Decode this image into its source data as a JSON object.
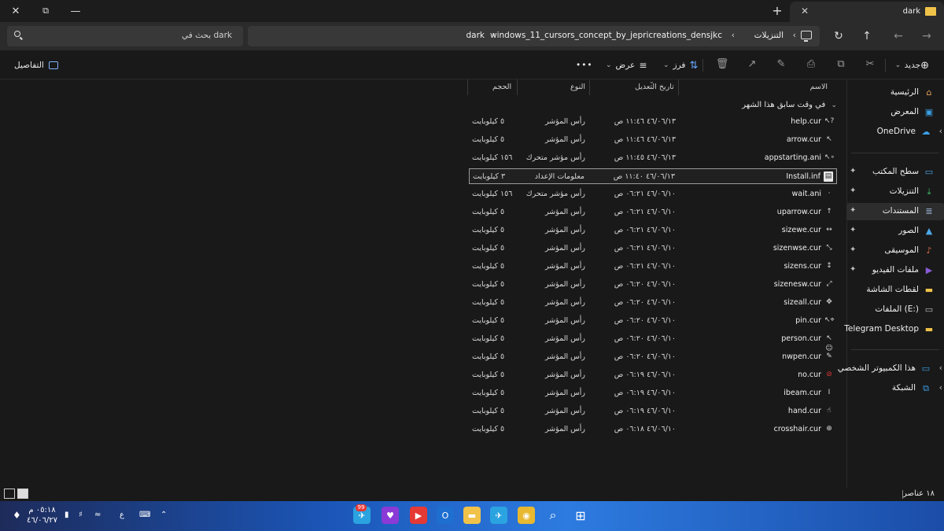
{
  "window": {
    "tab_title": "dark",
    "new_tab_symbol": "+",
    "close_symbol": "✕",
    "minimize_symbol": "—",
    "restore_symbol": "⧉"
  },
  "address": {
    "crumbs": [
      "dark",
      "windows_11_cursors_concept_by_jepricreations_densjkc",
      "التنزيلات"
    ],
    "search_placeholder": "بحث في dark"
  },
  "commands": {
    "new_label": "جديد",
    "sort_label": "فرز",
    "view_label": "عرض",
    "more_label": "•••",
    "details_label": "التفاصيل"
  },
  "nav": [
    {
      "label": "الرئيسية",
      "icon": "home-icon",
      "glyph": "⌂",
      "color": "#e8a35a",
      "group": 1
    },
    {
      "label": "المعرض",
      "icon": "gallery-icon",
      "glyph": "▣",
      "color": "#3aa0e6",
      "group": 1
    },
    {
      "label": "OneDrive",
      "icon": "cloud-icon",
      "glyph": "☁",
      "color": "#3aa0e6",
      "group": 1,
      "chev": true
    },
    {
      "label": "سطح المكتب",
      "icon": "desktop-icon",
      "glyph": "▭",
      "color": "#4aa8e8",
      "group": 2,
      "pin": true
    },
    {
      "label": "التنزيلات",
      "icon": "download-icon",
      "glyph": "⤓",
      "color": "#3cc46a",
      "group": 2,
      "pin": true
    },
    {
      "label": "المستندات",
      "icon": "document-icon",
      "glyph": "≣",
      "color": "#9ab6d6",
      "group": 2,
      "pin": true,
      "selected": true
    },
    {
      "label": "الصور",
      "icon": "pictures-icon",
      "glyph": "▲",
      "color": "#4aa8e8",
      "group": 2,
      "pin": true
    },
    {
      "label": "الموسيقى",
      "icon": "music-icon",
      "glyph": "♪",
      "color": "#e07050",
      "group": 2,
      "pin": true
    },
    {
      "label": "ملفات الفيديو",
      "icon": "video-icon",
      "glyph": "▶",
      "color": "#8a5ad6",
      "group": 2,
      "pin": true
    },
    {
      "label": "لقطات الشاشة",
      "icon": "folder-icon",
      "glyph": "▬",
      "color": "#f0c24a",
      "group": 2
    },
    {
      "label": "الملفات (E:)",
      "icon": "drive-icon",
      "glyph": "▭",
      "color": "#bdbdbd",
      "group": 2
    },
    {
      "label": "Telegram Desktop",
      "icon": "folder-icon",
      "glyph": "▬",
      "color": "#f0c24a",
      "group": 2
    },
    {
      "label": "هذا الكمبيوتر الشخصي",
      "icon": "pc-icon",
      "glyph": "▭",
      "color": "#3aa0e6",
      "group": 3,
      "chev": true
    },
    {
      "label": "الشبكة",
      "icon": "network-icon",
      "glyph": "⧉",
      "color": "#3aa0e6",
      "group": 3,
      "chev": true
    }
  ],
  "columns": {
    "name": "الاسم",
    "date": "تاريخ التعديل",
    "type": "النوع",
    "size": "الحجم"
  },
  "group_header": "في وقت سابق هذا الشهر",
  "files": [
    {
      "name": "help.cur",
      "date": "٤٦/٠٦/١٣ ١١:٤٦ ص",
      "type": "رأس المؤشر",
      "size": "٥ كيلوبايت",
      "icon": "help-cursor-icon",
      "glyph": "↖?"
    },
    {
      "name": "arrow.cur",
      "date": "٤٦/٠٦/١٣ ١١:٤٦ ص",
      "type": "رأس المؤشر",
      "size": "٥ كيلوبايت",
      "icon": "arrow-cursor-icon",
      "glyph": "↖"
    },
    {
      "name": "appstarting.ani",
      "date": "٤٦/٠٦/١٣ ١١:٤٥ ص",
      "type": "رأس مؤشر متحرك",
      "size": "١٥٦ كيلوبايت",
      "icon": "busy-arrow-cursor-icon",
      "glyph": "↖∘"
    },
    {
      "name": "Install.inf",
      "date": "٤٦/٠٦/١٣ ١١:٤٠ ص",
      "type": "معلومات الإعداد",
      "size": "٣ كيلوبايت",
      "icon": "setup-file-icon",
      "glyph": "▤",
      "selected": true
    },
    {
      "name": "wait.ani",
      "date": "٤٦/٠٦/١٠ ٠٦:٢١ ص",
      "type": "رأس مؤشر متحرك",
      "size": "١٥٦ كيلوبايت",
      "icon": "wait-cursor-icon",
      "glyph": "·"
    },
    {
      "name": "uparrow.cur",
      "date": "٤٦/٠٦/١٠ ٠٦:٢١ ص",
      "type": "رأس المؤشر",
      "size": "٥ كيلوبايت",
      "icon": "uparrow-cursor-icon",
      "glyph": "↑"
    },
    {
      "name": "sizewe.cur",
      "date": "٤٦/٠٦/١٠ ٠٦:٢١ ص",
      "type": "رأس المؤشر",
      "size": "٥ كيلوبايت",
      "icon": "size-we-cursor-icon",
      "glyph": "↔"
    },
    {
      "name": "sizenwse.cur",
      "date": "٤٦/٠٦/١٠ ٠٦:٢١ ص",
      "type": "رأس المؤشر",
      "size": "٥ كيلوبايت",
      "icon": "size-nwse-cursor-icon",
      "glyph": "⤡"
    },
    {
      "name": "sizens.cur",
      "date": "٤٦/٠٦/١٠ ٠٦:٢١ ص",
      "type": "رأس المؤشر",
      "size": "٥ كيلوبايت",
      "icon": "size-ns-cursor-icon",
      "glyph": "↕"
    },
    {
      "name": "sizenesw.cur",
      "date": "٤٦/٠٦/١٠ ٠٦:٢٠ ص",
      "type": "رأس المؤشر",
      "size": "٥ كيلوبايت",
      "icon": "size-nesw-cursor-icon",
      "glyph": "⤢"
    },
    {
      "name": "sizeall.cur",
      "date": "٤٦/٠٦/١٠ ٠٦:٢٠ ص",
      "type": "رأس المؤشر",
      "size": "٥ كيلوبايت",
      "icon": "move-cursor-icon",
      "glyph": "✥"
    },
    {
      "name": "pin.cur",
      "date": "٤٦/٠٦/١٠ ٠٦:٢٠ ص",
      "type": "رأس المؤشر",
      "size": "٥ كيلوبايت",
      "icon": "pin-cursor-icon",
      "glyph": "↖⌖"
    },
    {
      "name": "person.cur",
      "date": "٤٦/٠٦/١٠ ٠٦:٢٠ ص",
      "type": "رأس المؤشر",
      "size": "٥ كيلوبايت",
      "icon": "person-cursor-icon",
      "glyph": "↖☺"
    },
    {
      "name": "nwpen.cur",
      "date": "٤٦/٠٦/١٠ ٠٦:٢٠ ص",
      "type": "رأس المؤشر",
      "size": "٥ كيلوبايت",
      "icon": "pen-cursor-icon",
      "glyph": "✎"
    },
    {
      "name": "no.cur",
      "date": "٤٦/٠٦/١٠ ٠٦:١٩ ص",
      "type": "رأس المؤشر",
      "size": "٥ كيلوبايت",
      "icon": "no-cursor-icon",
      "glyph": "⊘",
      "glyph_color": "#e53935"
    },
    {
      "name": "ibeam.cur",
      "date": "٤٦/٠٦/١٠ ٠٦:١٩ ص",
      "type": "رأس المؤشر",
      "size": "٥ كيلوبايت",
      "icon": "ibeam-cursor-icon",
      "glyph": "I"
    },
    {
      "name": "hand.cur",
      "date": "٤٦/٠٦/١٠ ٠٦:١٩ ص",
      "type": "رأس المؤشر",
      "size": "٥ كيلوبايت",
      "icon": "hand-cursor-icon",
      "glyph": "☝"
    },
    {
      "name": "crosshair.cur",
      "date": "٤٦/٠٦/١٠ ٠٦:١٨ ص",
      "type": "رأس المؤشر",
      "size": "٥ كيلوبايت",
      "icon": "crosshair-cursor-icon",
      "glyph": "⊕"
    }
  ],
  "status": {
    "item_count": "١٨ عناصر"
  },
  "taskbar": {
    "clock_time": "٠٥:١٨ م",
    "clock_date": "٤٦/٠٦/٢٧",
    "keyboard_lang": "ع",
    "telegram_badge": "99",
    "apps": [
      {
        "icon": "telegram-icon",
        "glyph": "✈",
        "color": "#2aa3e0"
      },
      {
        "icon": "heart-app-icon",
        "glyph": "♥",
        "color": "#8a3ad6"
      },
      {
        "icon": "youtube-icon",
        "glyph": "▶",
        "color": "#e53935"
      },
      {
        "icon": "outlook-icon",
        "glyph": "O",
        "color": "#1e6fd0"
      },
      {
        "icon": "file-explorer-icon",
        "glyph": "▬",
        "color": "#f0c24a"
      },
      {
        "icon": "telegram-icon",
        "glyph": "✈",
        "color": "#2aa3e0"
      },
      {
        "icon": "chrome-icon",
        "glyph": "◉",
        "color": "#e8b830"
      },
      {
        "icon": "search-icon",
        "glyph": "⌕",
        "color": "transparent"
      },
      {
        "icon": "start-icon",
        "glyph": "⊞",
        "color": "transparent"
      }
    ]
  },
  "colors": {
    "accent_folder": "#f0c24a",
    "selection_border": "#9a9a9a",
    "background": "#191919"
  }
}
